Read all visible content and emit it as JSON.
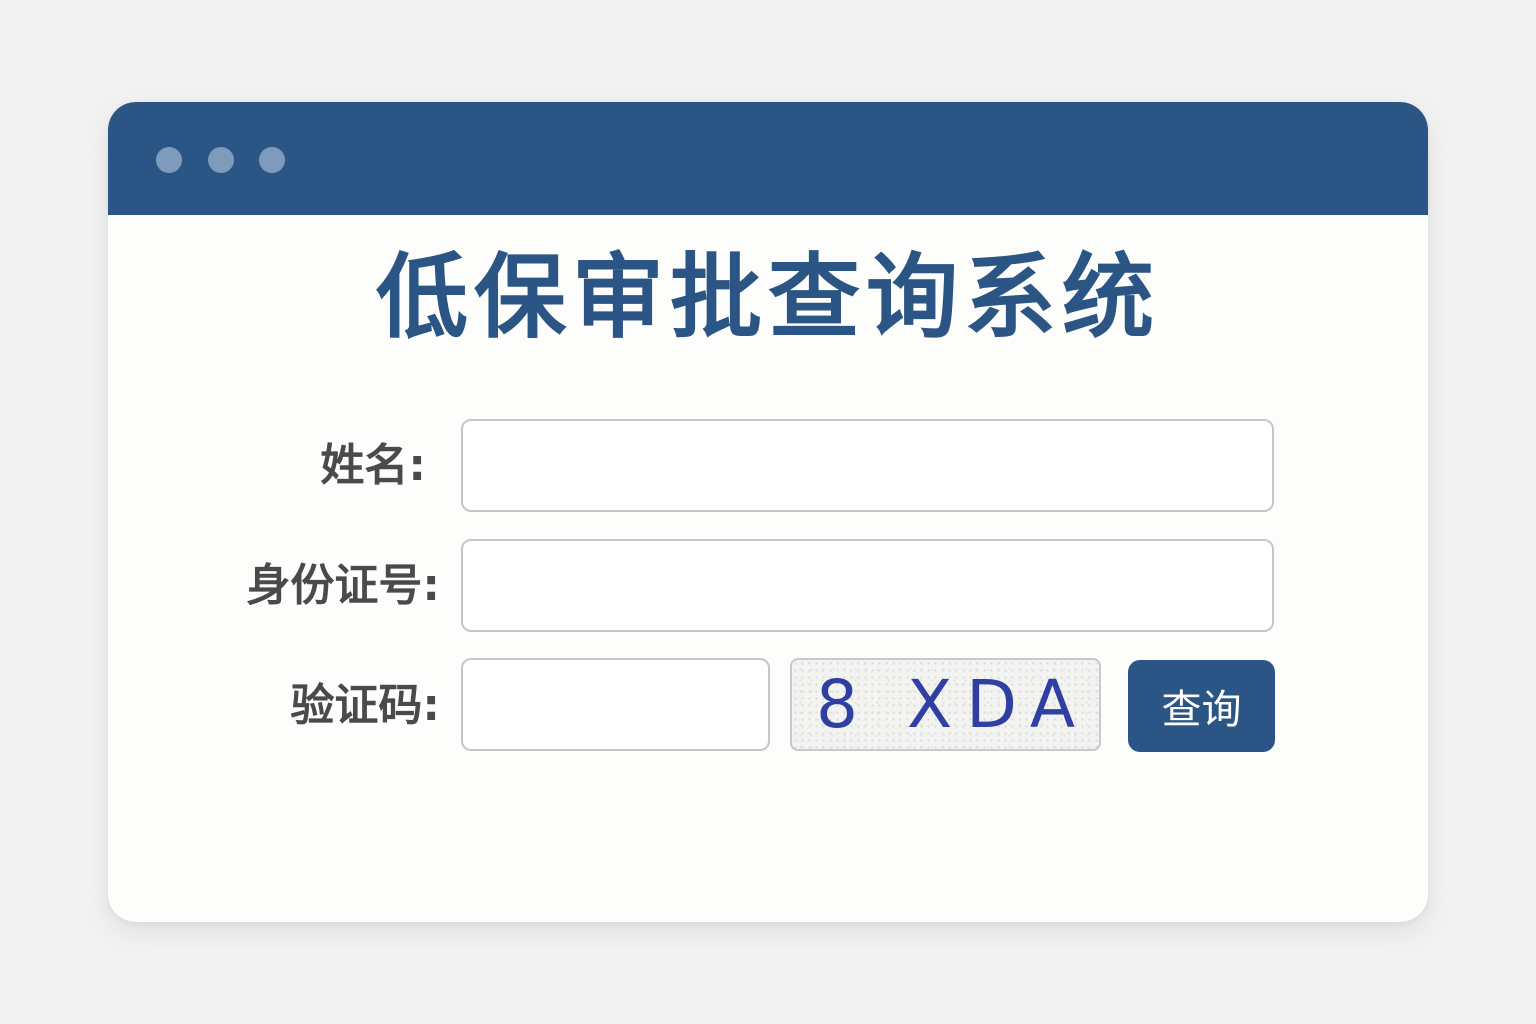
{
  "window": {
    "title": "低保审批查询系统",
    "controls": [
      "dot",
      "dot",
      "dot"
    ]
  },
  "form": {
    "name_label": "姓名:",
    "name_value": "",
    "id_label": "身份证号:",
    "id_value": "",
    "captcha_label": "验证码:",
    "captcha_value": "",
    "captcha_image_text": "8 XDA",
    "submit_label": "查询"
  },
  "colors": {
    "primary": "#2b5584",
    "label_text": "#4a4a4a",
    "captcha_text": "#2f3fa2",
    "background": "#f1f2f1"
  }
}
